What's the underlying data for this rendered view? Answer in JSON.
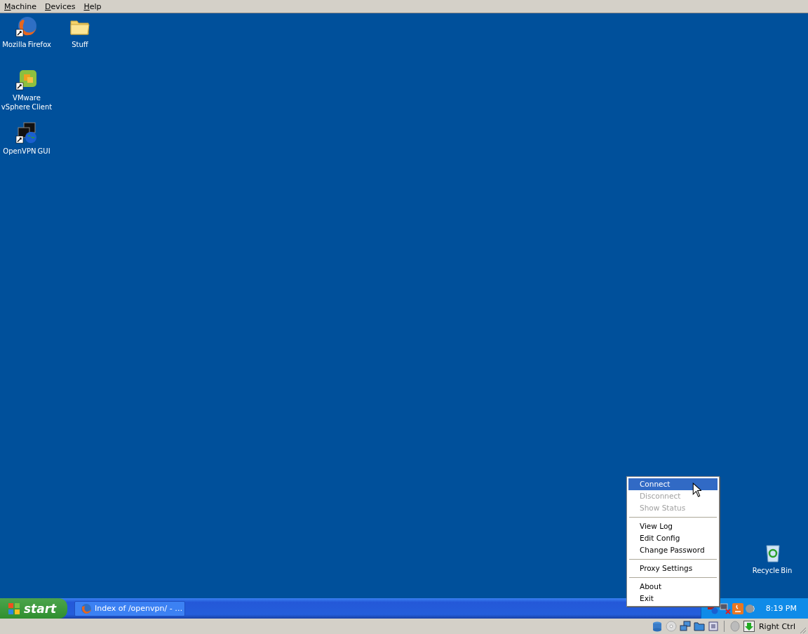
{
  "menu_bar": {
    "items": [
      {
        "label": "Machine"
      },
      {
        "label": "Devices"
      },
      {
        "label": "Help"
      }
    ]
  },
  "desktop": {
    "icons": [
      {
        "label": "Mozilla Firefox",
        "kind": "browser",
        "shortcut": true
      },
      {
        "label": "Stuff",
        "kind": "folder",
        "shortcut": false
      },
      {
        "label": "VMware vSphere Client",
        "kind": "vmware",
        "shortcut": true
      },
      {
        "label": "OpenVPN GUI",
        "kind": "vpn",
        "shortcut": true
      }
    ],
    "recycle_bin": {
      "label": "Recycle Bin"
    }
  },
  "context_menu": {
    "items": [
      {
        "kind": "item",
        "label": "Connect",
        "selected": true,
        "disabled": false
      },
      {
        "kind": "item",
        "label": "Disconnect",
        "selected": false,
        "disabled": true
      },
      {
        "kind": "item",
        "label": "Show Status",
        "selected": false,
        "disabled": true
      },
      {
        "kind": "separator"
      },
      {
        "kind": "item",
        "label": "View Log",
        "selected": false,
        "disabled": false
      },
      {
        "kind": "item",
        "label": "Edit Config",
        "selected": false,
        "disabled": false
      },
      {
        "kind": "item",
        "label": "Change Password",
        "selected": false,
        "disabled": false
      },
      {
        "kind": "separator"
      },
      {
        "kind": "item",
        "label": "Proxy Settings",
        "selected": false,
        "disabled": false
      },
      {
        "kind": "separator"
      },
      {
        "kind": "item",
        "label": "About",
        "selected": false,
        "disabled": false
      },
      {
        "kind": "item",
        "label": "Exit",
        "selected": false,
        "disabled": false
      }
    ]
  },
  "taskbar": {
    "start": "start",
    "tasks": [
      {
        "label": "Index of /openvpn/ - …"
      }
    ],
    "clock": "8:19 PM"
  },
  "status_bar": {
    "host_key": "Right Ctrl"
  }
}
